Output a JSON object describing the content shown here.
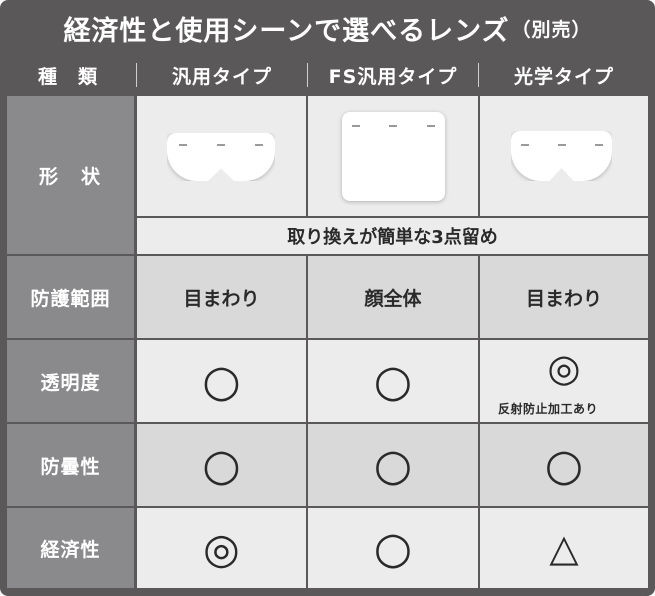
{
  "title": {
    "main": "経済性と使用シーンで選べるレンズ",
    "suffix": "（別売）"
  },
  "header": {
    "kind_label": "種　類",
    "columns": [
      "汎用タイプ",
      "FS汎用タイプ",
      "光学タイプ"
    ]
  },
  "rows": {
    "shape": {
      "label": "形　状",
      "note": "取り換えが簡単な3点留め"
    },
    "protection": {
      "label": "防護範囲",
      "values": [
        "目まわり",
        "顔全体",
        "目まわり"
      ]
    },
    "transparency": {
      "label": "透明度",
      "values": [
        "○",
        "○",
        "◎"
      ],
      "note": "反射防止加工あり"
    },
    "antifog": {
      "label": "防曇性",
      "values": [
        "○",
        "○",
        "○"
      ]
    },
    "economy": {
      "label": "経済性",
      "values": [
        "◎",
        "○",
        "△"
      ]
    }
  }
}
